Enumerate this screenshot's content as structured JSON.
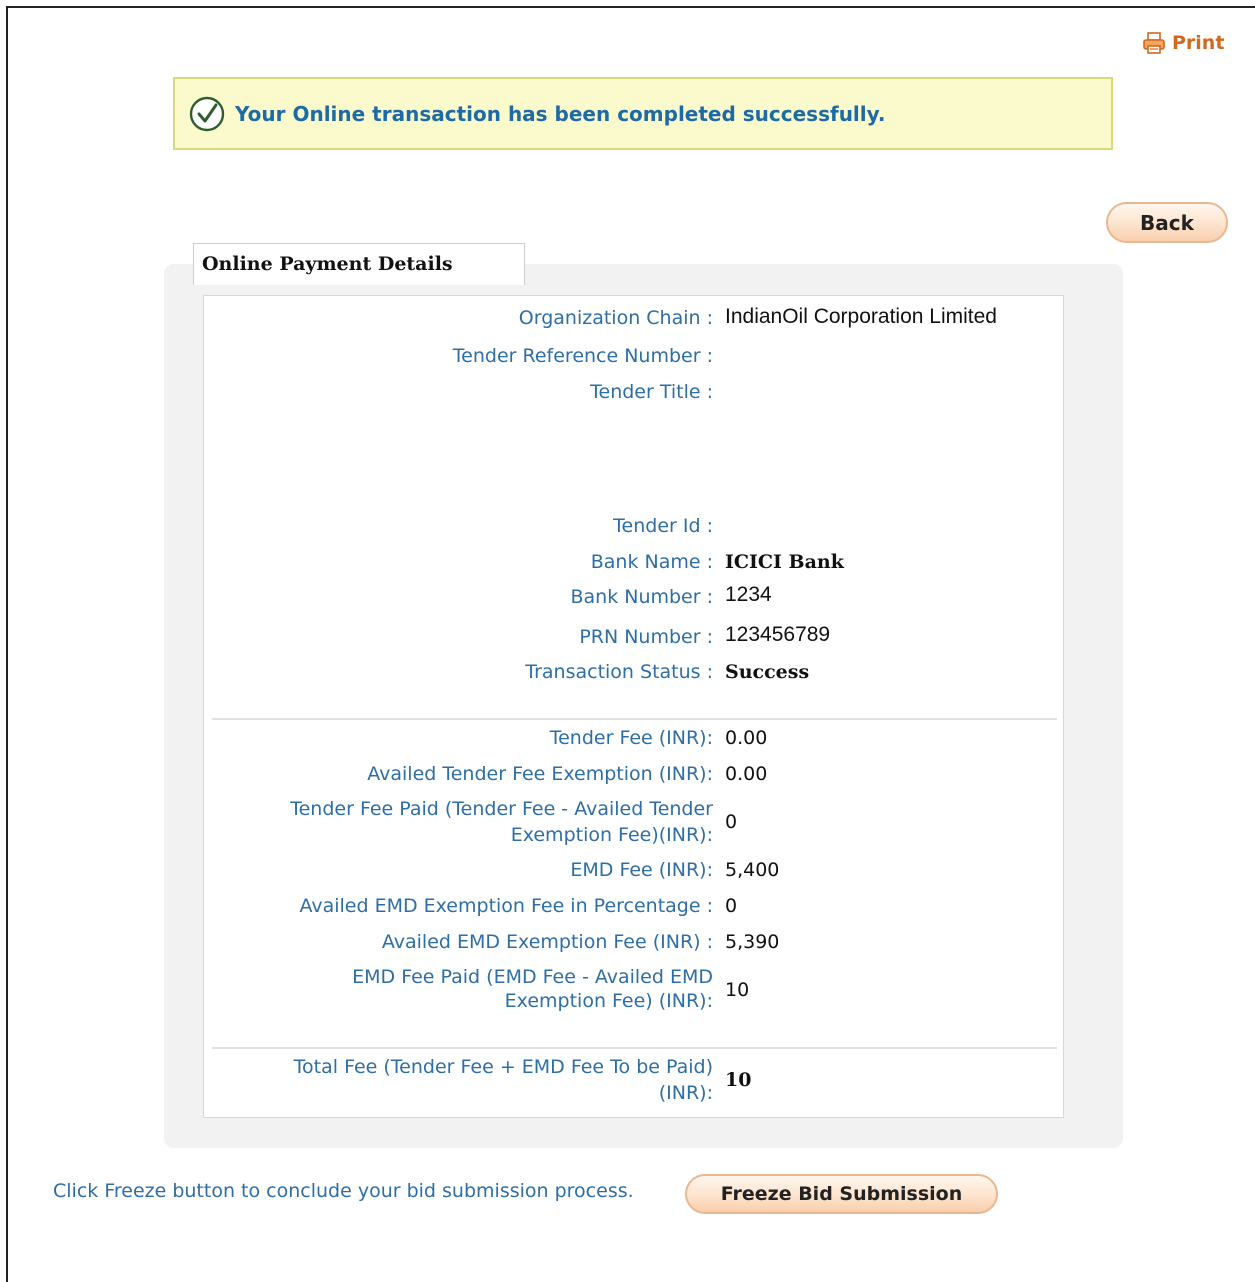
{
  "toolbar": {
    "print_label": "Print"
  },
  "banner": {
    "message": "Your Online transaction has been completed successfully."
  },
  "back_label": "Back",
  "section_title": "Online Payment Details",
  "details": {
    "org_chain_label": "Organization Chain :",
    "org_chain_value": "IndianOil Corporation Limited",
    "tender_ref_label": "Tender Reference Number :",
    "tender_ref_value": "",
    "tender_title_label": "Tender Title :",
    "tender_title_value": "",
    "tender_id_label": "Tender Id :",
    "tender_id_value": "",
    "bank_name_label": "Bank Name :",
    "bank_name_value": "ICICI Bank",
    "bank_number_label": "Bank Number :",
    "bank_number_value": "1234",
    "prn_label": "PRN Number :",
    "prn_value": "123456789",
    "status_label": "Transaction Status :",
    "status_value": "Success"
  },
  "fees": {
    "tender_fee_label": "Tender Fee (INR):",
    "tender_fee_value": "0.00",
    "availed_tender_exemption_label": "Availed Tender Fee Exemption (INR):",
    "availed_tender_exemption_value": "0.00",
    "tender_fee_paid_label_1": "Tender Fee Paid (Tender Fee - Availed Tender",
    "tender_fee_paid_label_2": "Exemption Fee)(INR):",
    "tender_fee_paid_value": "0",
    "emd_fee_label": "EMD Fee (INR):",
    "emd_fee_value": "5,400",
    "emd_exemption_pct_label": "Availed EMD Exemption Fee in Percentage :",
    "emd_exemption_pct_value": "0",
    "emd_exemption_label": "Availed EMD Exemption Fee (INR) :",
    "emd_exemption_value": "5,390",
    "emd_fee_paid_label_1": "EMD Fee Paid (EMD Fee - Availed EMD",
    "emd_fee_paid_label_2": "Exemption Fee) (INR):",
    "emd_fee_paid_value": "10"
  },
  "total": {
    "label_1": "Total Fee (Tender Fee + EMD Fee To be Paid)",
    "label_2": "(INR):",
    "value": "10"
  },
  "footer": {
    "instruction": "Click Freeze button to conclude your bid submission process.",
    "freeze_label": "Freeze Bid Submission"
  },
  "colors": {
    "label_blue": "#2e6ea6",
    "banner_bg": "#fafacd",
    "button_peach": "#fde3cc",
    "print_orange": "#d2691e"
  }
}
